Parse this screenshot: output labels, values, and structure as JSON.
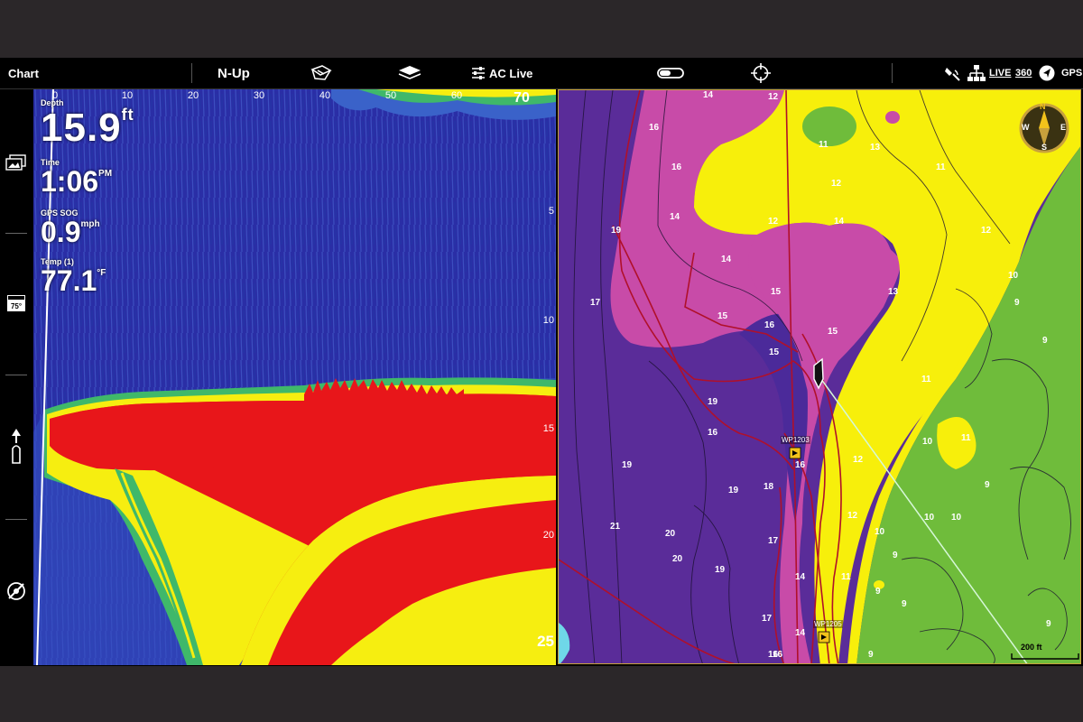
{
  "topbar": {
    "mode_label": "Chart",
    "orientation_label": "N-Up",
    "ac_live_label": "AC Live",
    "live_label": "LIVE",
    "degrees_label": "360",
    "gps_label": "GPS"
  },
  "sidebar": {
    "icons": [
      "images-icon",
      "temperature-icon",
      "boat-icon",
      "sonar-swirl-icon"
    ],
    "temp_badge": "75°"
  },
  "sonar": {
    "x_ticks": [
      "0",
      "10",
      "20",
      "30",
      "40",
      "50",
      "60",
      "70"
    ],
    "y_ticks": [
      "5",
      "10",
      "15",
      "20"
    ],
    "max_depth_label": "25",
    "readouts": {
      "depth_label": "Depth",
      "depth_value": "15.9",
      "depth_unit": "ft",
      "time_label": "Time",
      "time_value": "1:06",
      "time_unit": "PM",
      "sog_label": "GPS SOG",
      "sog_value": "0.9",
      "sog_unit": "mph",
      "temp_label": "Temp (1)",
      "temp_value": "77.1",
      "temp_unit": "°F"
    }
  },
  "chart": {
    "waypoints": [
      "WP1203",
      "WP1205"
    ],
    "scale_label": "200 ft",
    "compass": {
      "n": "N",
      "e": "E",
      "s": "S",
      "w": "W"
    },
    "contours": [
      "14",
      "12",
      "11",
      "13",
      "12",
      "11",
      "12",
      "16",
      "16",
      "14",
      "12",
      "10",
      "14",
      "15",
      "15",
      "14",
      "13",
      "17",
      "19",
      "19",
      "16",
      "15",
      "15",
      "16",
      "19",
      "11",
      "12",
      "10",
      "10",
      "9",
      "9",
      "9",
      "11",
      "12",
      "10",
      "9",
      "16",
      "18",
      "19",
      "21",
      "20",
      "20",
      "19",
      "17",
      "17",
      "16",
      "14",
      "11",
      "10",
      "9",
      "9",
      "9",
      "9",
      "16",
      "14"
    ]
  },
  "colors": {
    "accent": "#c8a13c",
    "sonar_red": "#e8161a",
    "sonar_yellow": "#f6ee10",
    "sonar_blue": "#2a2ea6",
    "chart_purple": "#5a2c99",
    "chart_magenta": "#c84ba8",
    "chart_yellow": "#f7ef0b",
    "chart_green": "#6fbc3b"
  }
}
